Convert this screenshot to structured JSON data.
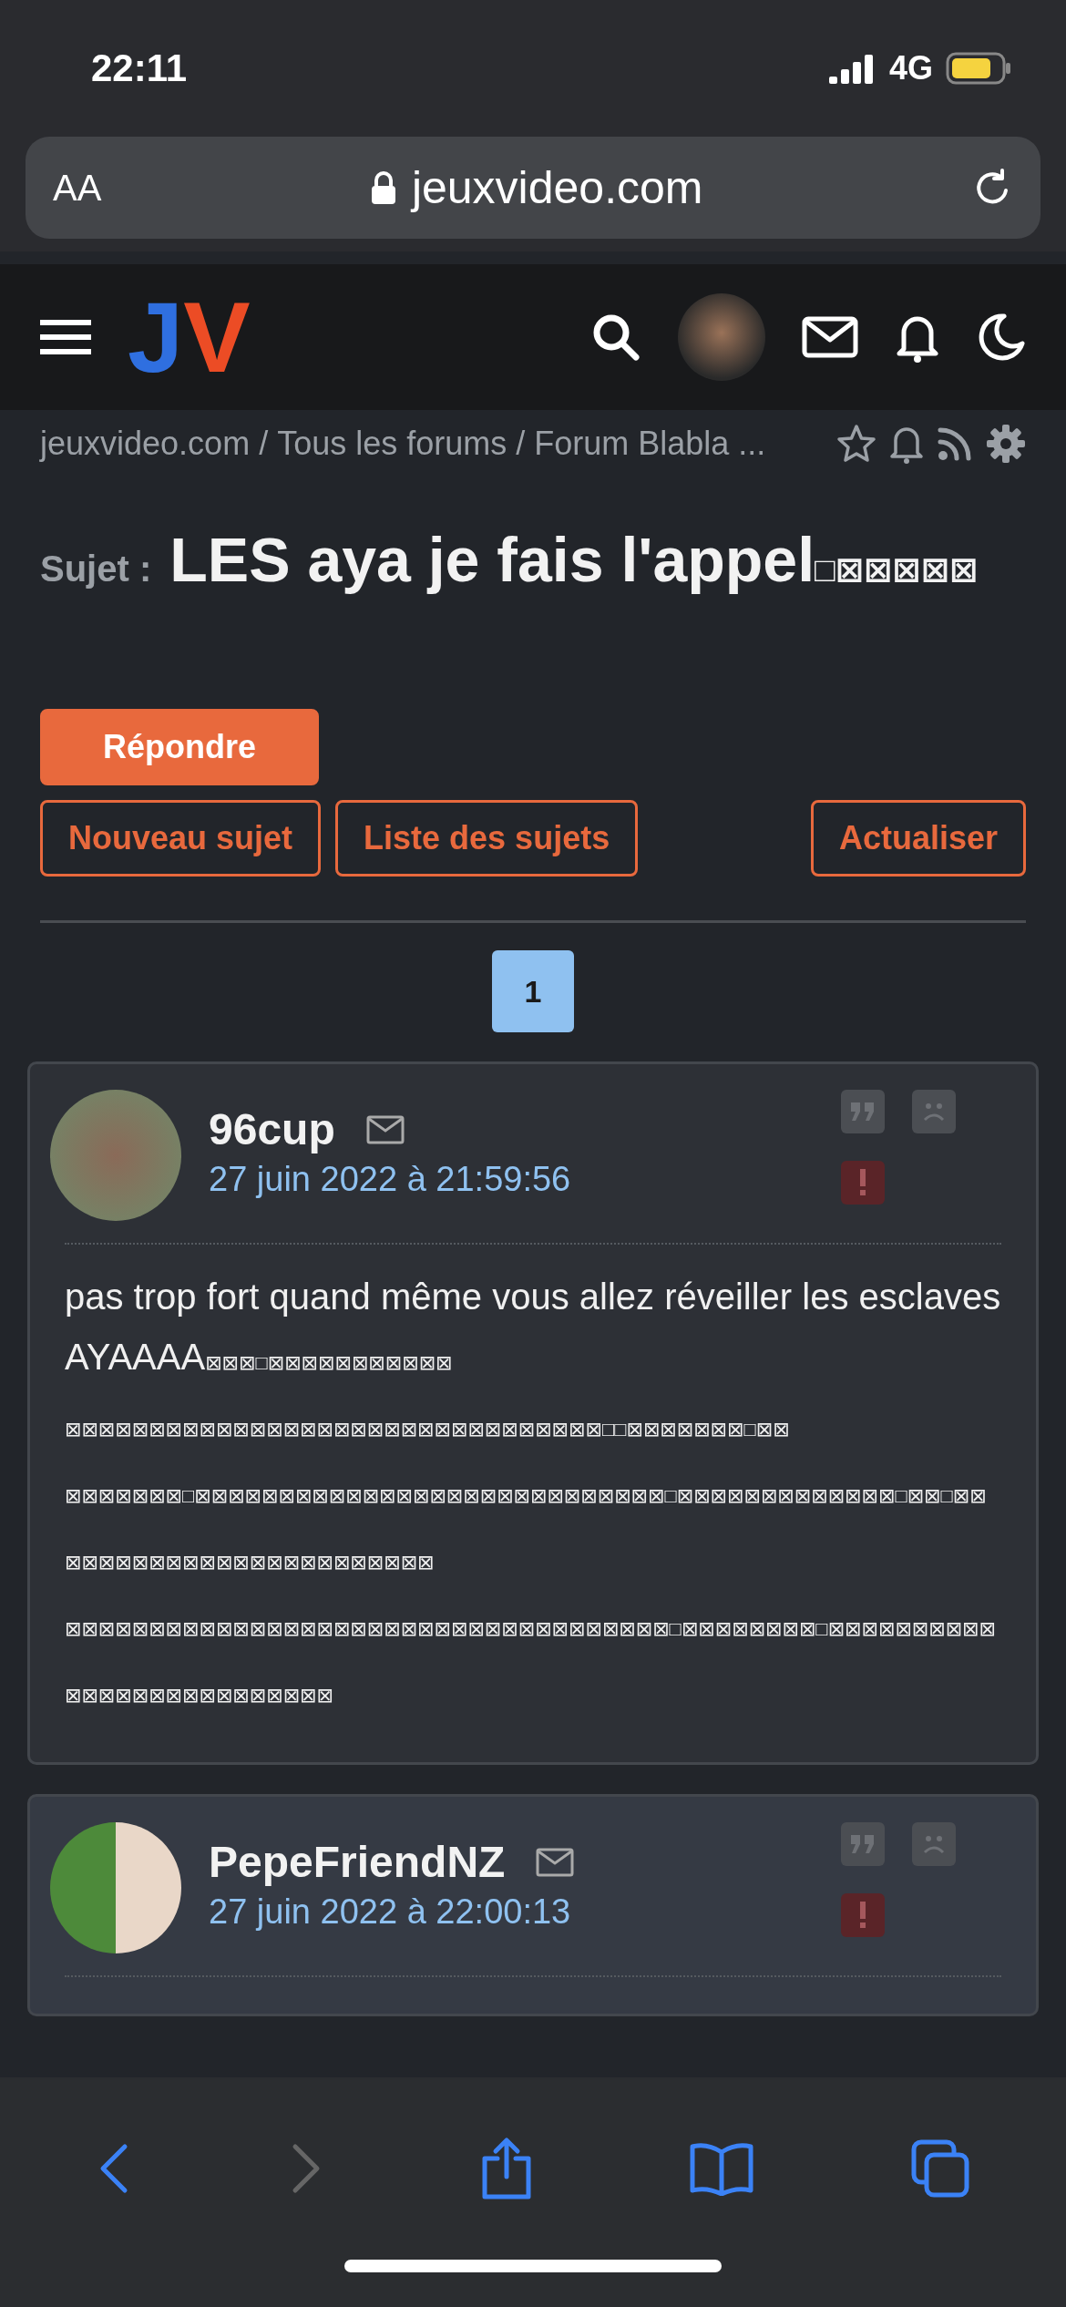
{
  "status_bar": {
    "time": "22:11",
    "network": "4G"
  },
  "url_bar": {
    "text_size_button": "AA",
    "domain": "jeuxvideo.com"
  },
  "header": {
    "logo_letters": [
      "J",
      "V"
    ]
  },
  "breadcrumb": {
    "items": [
      "jeuxvideo.com",
      "Tous les forums",
      "Forum Blabla ..."
    ],
    "separator": "/"
  },
  "topic": {
    "label": "Sujet :",
    "title": "LES aya je fais l'appel□⊠⊠⊠⊠⊠"
  },
  "buttons": [
    {
      "label": "Répondre",
      "kind": "primary"
    },
    {
      "label": "Nouveau sujet",
      "kind": "outline"
    },
    {
      "label": "Liste des sujets",
      "kind": "outline"
    },
    {
      "label": "Actualiser",
      "kind": "outline"
    }
  ],
  "pagination": [
    {
      "label": "1",
      "selected": true
    }
  ],
  "posts": [
    {
      "author": "96cup",
      "date": "27 juin 2022 à 21:59:56",
      "highlighted": false,
      "body": [
        "pas trop fort quand même vous allez réveiller les esclaves AYAAAA⊠⊠⊠□⊠⊠⊠⊠⊠⊠⊠⊠⊠⊠⊠",
        "⊠⊠⊠⊠⊠⊠⊠⊠⊠⊠⊠⊠⊠⊠⊠⊠⊠⊠⊠⊠⊠⊠⊠⊠⊠⊠⊠⊠⊠⊠⊠⊠□□⊠⊠⊠⊠⊠⊠⊠□⊠⊠",
        "⊠⊠⊠⊠⊠⊠⊠□⊠⊠⊠⊠⊠⊠⊠⊠⊠⊠⊠⊠⊠⊠⊠⊠⊠⊠⊠⊠⊠⊠⊠⊠⊠⊠⊠⊠□⊠⊠⊠⊠⊠⊠⊠⊠⊠⊠⊠⊠⊠□⊠⊠□⊠⊠⊠⊠⊠⊠⊠⊠⊠⊠⊠⊠⊠⊠⊠⊠⊠⊠⊠⊠⊠⊠⊠⊠",
        "⊠⊠⊠⊠⊠⊠⊠⊠⊠⊠⊠⊠⊠⊠⊠⊠⊠⊠⊠⊠⊠⊠⊠⊠⊠⊠⊠⊠⊠⊠⊠⊠⊠⊠⊠⊠□⊠⊠⊠⊠⊠⊠⊠⊠□⊠⊠⊠⊠⊠⊠⊠⊠⊠⊠⊠⊠⊠⊠⊠⊠⊠⊠⊠⊠⊠⊠⊠⊠⊠⊠"
      ]
    },
    {
      "author": "PepeFriendNZ",
      "date": "27 juin 2022 à 22:00:13",
      "highlighted": true
    }
  ],
  "browser_toolbar": {
    "back_enabled": true,
    "forward_enabled": false
  }
}
